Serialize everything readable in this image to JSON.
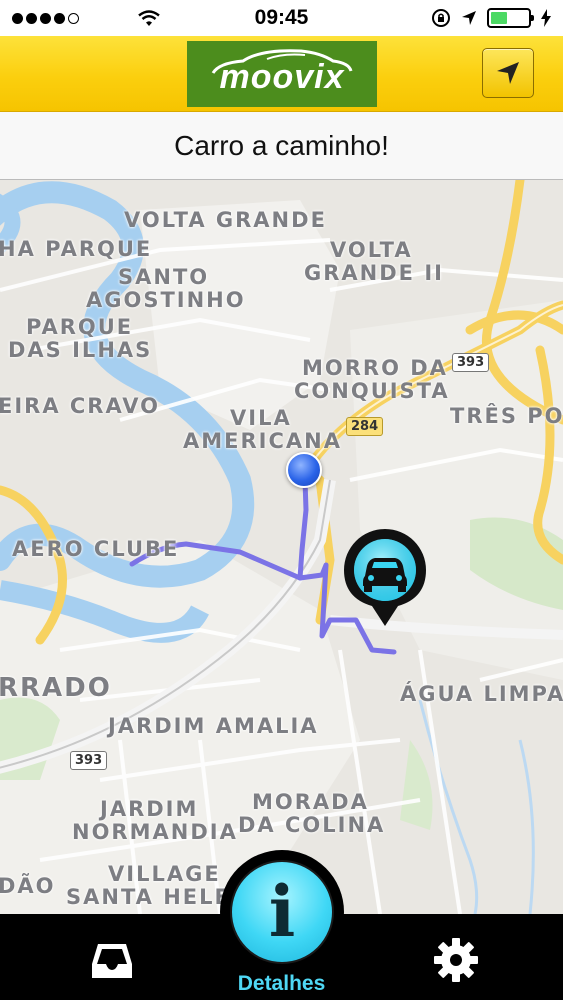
{
  "status_bar": {
    "time": "09:45",
    "signal_dots": 5,
    "signal_filled": 4,
    "battery_level": 0.45,
    "icons": [
      "wifi-icon",
      "rotation-lock-icon",
      "location-arrow-icon",
      "battery-icon",
      "charging-bolt-icon"
    ]
  },
  "header": {
    "logo_text": "moovix",
    "brand_color": "#4c8d1d",
    "accent_color": "#fbcf0e",
    "locate_icon": "navigation-arrow-icon"
  },
  "banner": {
    "title": "Carro a caminho!"
  },
  "map": {
    "labels": {
      "volta_grande": "VOLTA GRANDE",
      "ha_parque": "HA PARQUE",
      "volta_grande_ii_1": "VOLTA",
      "volta_grande_ii_2": "GRANDE II",
      "santo_agostinho_1": "SANTO",
      "santo_agostinho_2": "AGOSTINHO",
      "parque_ilhas_1": "PARQUE",
      "parque_ilhas_2": "DAS ILHAS",
      "morro_conquista_1": "MORRO DA",
      "morro_conquista_2": "CONQUISTA",
      "eira_cravo": "EIRA CRAVO",
      "vila_americana_1": "VILA",
      "vila_americana_2": "AMERICANA",
      "tres_poc": "TRÊS POC",
      "aero_clube": "AERO CLUBE",
      "rrado": "RRADO",
      "agua_limpa": "ÁGUA LIMPA",
      "jardim_amalia": "JARDIM AMALIA",
      "jardim_normandia_1": "JARDIM",
      "jardim_normandia_2": "NORMANDIA",
      "morada_colina_1": "MORADA",
      "morada_colina_2": "DA COLINA",
      "village_1": "VILLAGE",
      "village_2": "SANTA HELE",
      "dao": "DÃO"
    },
    "road_shields": {
      "r393_top": "393",
      "r284": "284",
      "r393_bottom": "393"
    },
    "route_color": "#7b73e6",
    "origin_icon": "location-dot-icon",
    "vehicle_icon": "car-marker-icon"
  },
  "bottom_nav": {
    "inbox_icon": "inbox-icon",
    "details_label": "Detalhes",
    "details_icon": "info-icon",
    "settings_icon": "gear-icon"
  }
}
